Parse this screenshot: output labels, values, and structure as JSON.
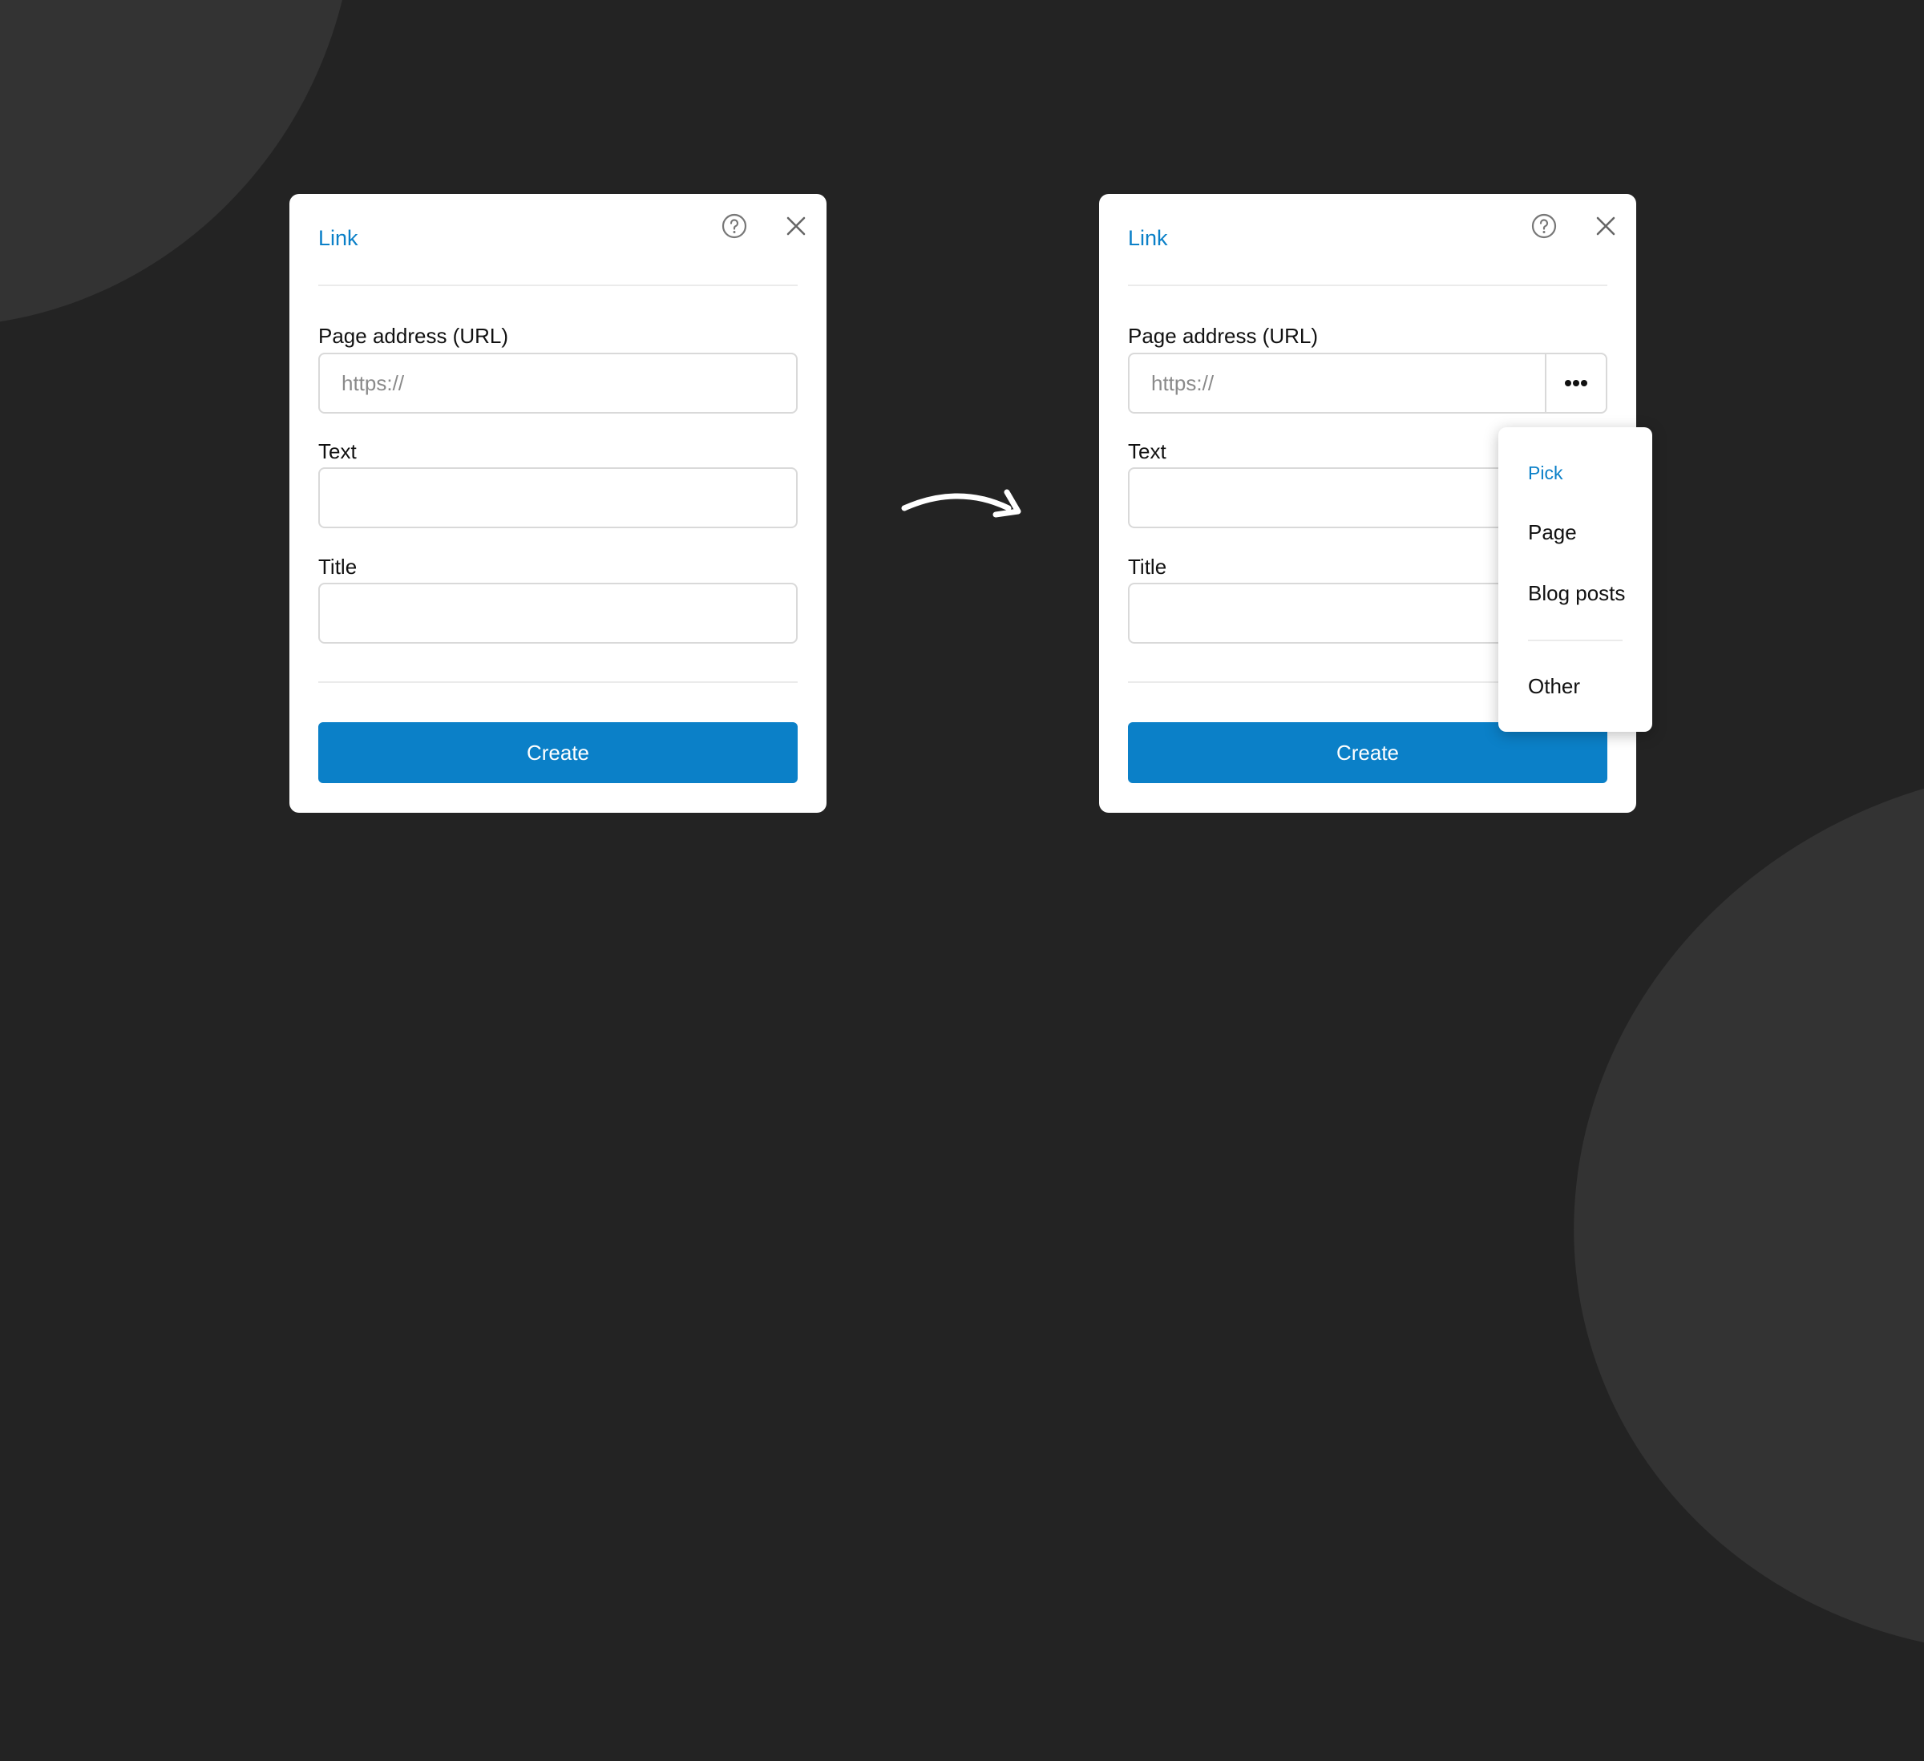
{
  "dialog_left": {
    "title": "Link",
    "url_label": "Page address (URL)",
    "url_placeholder": "https://",
    "text_label": "Text",
    "title_label": "Title",
    "create_label": "Create"
  },
  "dialog_right": {
    "title": "Link",
    "url_label": "Page address (URL)",
    "url_placeholder": "https://",
    "text_label": "Text",
    "title_label": "Title",
    "create_label": "Create"
  },
  "popup": {
    "heading": "Pick",
    "items": [
      "Page",
      "Blog posts"
    ],
    "other": "Other"
  },
  "icons": [
    "help-icon",
    "close-icon",
    "more-icon",
    "arrow-icon"
  ],
  "colors": {
    "accent": "#0b80c8",
    "background": "#232323",
    "decor": "#333333"
  }
}
